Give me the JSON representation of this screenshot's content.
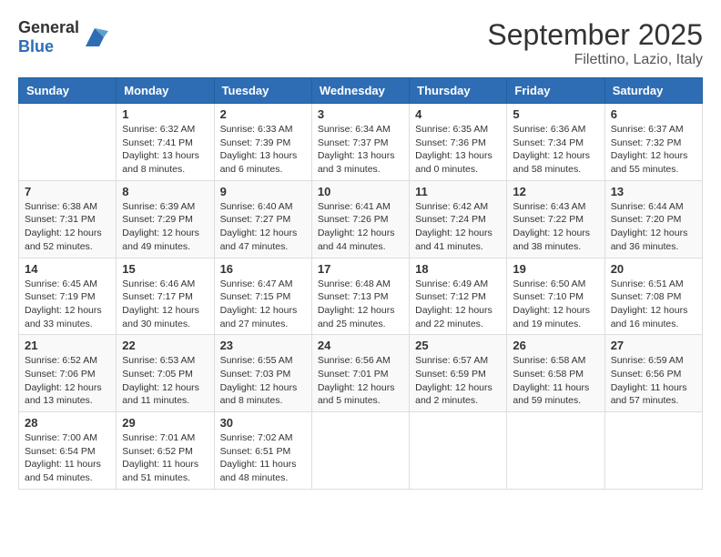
{
  "header": {
    "logo_general": "General",
    "logo_blue": "Blue",
    "month_year": "September 2025",
    "location": "Filettino, Lazio, Italy"
  },
  "weekdays": [
    "Sunday",
    "Monday",
    "Tuesday",
    "Wednesday",
    "Thursday",
    "Friday",
    "Saturday"
  ],
  "weeks": [
    [
      {
        "day": "",
        "info": ""
      },
      {
        "day": "1",
        "info": "Sunrise: 6:32 AM\nSunset: 7:41 PM\nDaylight: 13 hours\nand 8 minutes."
      },
      {
        "day": "2",
        "info": "Sunrise: 6:33 AM\nSunset: 7:39 PM\nDaylight: 13 hours\nand 6 minutes."
      },
      {
        "day": "3",
        "info": "Sunrise: 6:34 AM\nSunset: 7:37 PM\nDaylight: 13 hours\nand 3 minutes."
      },
      {
        "day": "4",
        "info": "Sunrise: 6:35 AM\nSunset: 7:36 PM\nDaylight: 13 hours\nand 0 minutes."
      },
      {
        "day": "5",
        "info": "Sunrise: 6:36 AM\nSunset: 7:34 PM\nDaylight: 12 hours\nand 58 minutes."
      },
      {
        "day": "6",
        "info": "Sunrise: 6:37 AM\nSunset: 7:32 PM\nDaylight: 12 hours\nand 55 minutes."
      }
    ],
    [
      {
        "day": "7",
        "info": "Sunrise: 6:38 AM\nSunset: 7:31 PM\nDaylight: 12 hours\nand 52 minutes."
      },
      {
        "day": "8",
        "info": "Sunrise: 6:39 AM\nSunset: 7:29 PM\nDaylight: 12 hours\nand 49 minutes."
      },
      {
        "day": "9",
        "info": "Sunrise: 6:40 AM\nSunset: 7:27 PM\nDaylight: 12 hours\nand 47 minutes."
      },
      {
        "day": "10",
        "info": "Sunrise: 6:41 AM\nSunset: 7:26 PM\nDaylight: 12 hours\nand 44 minutes."
      },
      {
        "day": "11",
        "info": "Sunrise: 6:42 AM\nSunset: 7:24 PM\nDaylight: 12 hours\nand 41 minutes."
      },
      {
        "day": "12",
        "info": "Sunrise: 6:43 AM\nSunset: 7:22 PM\nDaylight: 12 hours\nand 38 minutes."
      },
      {
        "day": "13",
        "info": "Sunrise: 6:44 AM\nSunset: 7:20 PM\nDaylight: 12 hours\nand 36 minutes."
      }
    ],
    [
      {
        "day": "14",
        "info": "Sunrise: 6:45 AM\nSunset: 7:19 PM\nDaylight: 12 hours\nand 33 minutes."
      },
      {
        "day": "15",
        "info": "Sunrise: 6:46 AM\nSunset: 7:17 PM\nDaylight: 12 hours\nand 30 minutes."
      },
      {
        "day": "16",
        "info": "Sunrise: 6:47 AM\nSunset: 7:15 PM\nDaylight: 12 hours\nand 27 minutes."
      },
      {
        "day": "17",
        "info": "Sunrise: 6:48 AM\nSunset: 7:13 PM\nDaylight: 12 hours\nand 25 minutes."
      },
      {
        "day": "18",
        "info": "Sunrise: 6:49 AM\nSunset: 7:12 PM\nDaylight: 12 hours\nand 22 minutes."
      },
      {
        "day": "19",
        "info": "Sunrise: 6:50 AM\nSunset: 7:10 PM\nDaylight: 12 hours\nand 19 minutes."
      },
      {
        "day": "20",
        "info": "Sunrise: 6:51 AM\nSunset: 7:08 PM\nDaylight: 12 hours\nand 16 minutes."
      }
    ],
    [
      {
        "day": "21",
        "info": "Sunrise: 6:52 AM\nSunset: 7:06 PM\nDaylight: 12 hours\nand 13 minutes."
      },
      {
        "day": "22",
        "info": "Sunrise: 6:53 AM\nSunset: 7:05 PM\nDaylight: 12 hours\nand 11 minutes."
      },
      {
        "day": "23",
        "info": "Sunrise: 6:55 AM\nSunset: 7:03 PM\nDaylight: 12 hours\nand 8 minutes."
      },
      {
        "day": "24",
        "info": "Sunrise: 6:56 AM\nSunset: 7:01 PM\nDaylight: 12 hours\nand 5 minutes."
      },
      {
        "day": "25",
        "info": "Sunrise: 6:57 AM\nSunset: 6:59 PM\nDaylight: 12 hours\nand 2 minutes."
      },
      {
        "day": "26",
        "info": "Sunrise: 6:58 AM\nSunset: 6:58 PM\nDaylight: 11 hours\nand 59 minutes."
      },
      {
        "day": "27",
        "info": "Sunrise: 6:59 AM\nSunset: 6:56 PM\nDaylight: 11 hours\nand 57 minutes."
      }
    ],
    [
      {
        "day": "28",
        "info": "Sunrise: 7:00 AM\nSunset: 6:54 PM\nDaylight: 11 hours\nand 54 minutes."
      },
      {
        "day": "29",
        "info": "Sunrise: 7:01 AM\nSunset: 6:52 PM\nDaylight: 11 hours\nand 51 minutes."
      },
      {
        "day": "30",
        "info": "Sunrise: 7:02 AM\nSunset: 6:51 PM\nDaylight: 11 hours\nand 48 minutes."
      },
      {
        "day": "",
        "info": ""
      },
      {
        "day": "",
        "info": ""
      },
      {
        "day": "",
        "info": ""
      },
      {
        "day": "",
        "info": ""
      }
    ]
  ]
}
